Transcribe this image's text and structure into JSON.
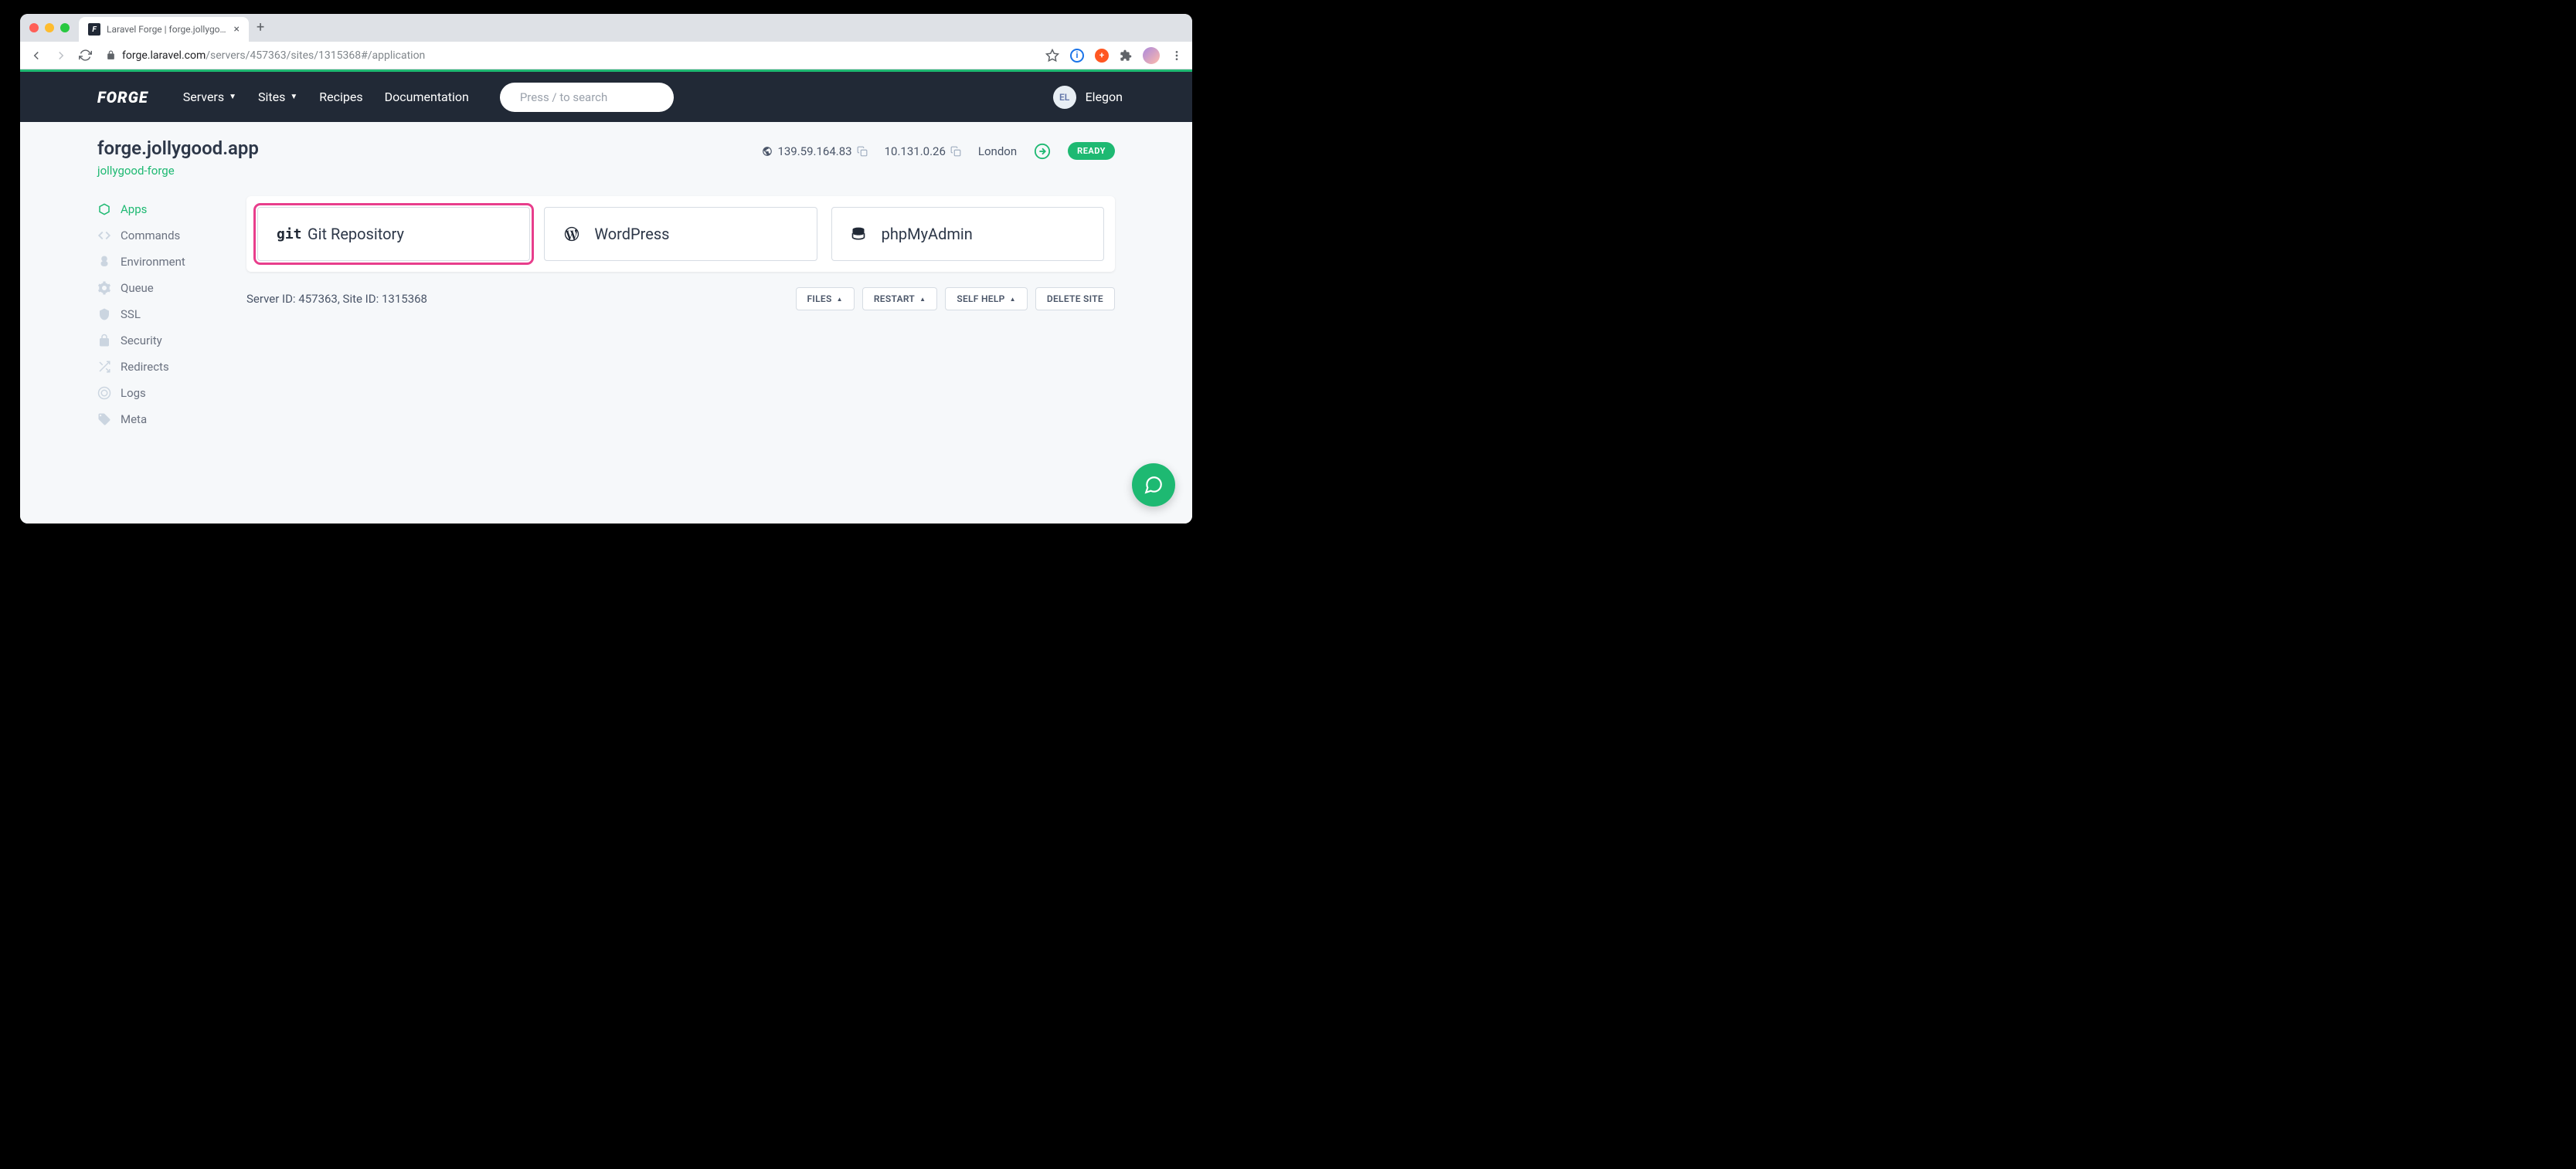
{
  "browser": {
    "tab_title": "Laravel Forge | forge.jollygood",
    "url_host": "forge.laravel.com",
    "url_path": "/servers/457363/sites/1315368#/application"
  },
  "nav": {
    "logo": "FORGE",
    "links": {
      "servers": "Servers",
      "sites": "Sites",
      "recipes": "Recipes",
      "docs": "Documentation"
    },
    "search_placeholder": "Press / to search",
    "user_initials": "EL",
    "user_name": "Elegon"
  },
  "header": {
    "site_title": "forge.jollygood.app",
    "server_name": "jollygood-forge",
    "public_ip": "139.59.164.83",
    "private_ip": "10.131.0.26",
    "location": "London",
    "status": "READY"
  },
  "sidebar": {
    "items": [
      {
        "label": "Apps",
        "icon": "cube-icon",
        "active": true
      },
      {
        "label": "Commands",
        "icon": "code-icon"
      },
      {
        "label": "Environment",
        "icon": "tree-icon"
      },
      {
        "label": "Queue",
        "icon": "gear-icon"
      },
      {
        "label": "SSL",
        "icon": "shield-icon"
      },
      {
        "label": "Security",
        "icon": "lock-icon"
      },
      {
        "label": "Redirects",
        "icon": "shuffle-icon"
      },
      {
        "label": "Logs",
        "icon": "target-icon"
      },
      {
        "label": "Meta",
        "icon": "tag-icon"
      }
    ]
  },
  "apps": {
    "git": "Git Repository",
    "wordpress": "WordPress",
    "phpmyadmin": "phpMyAdmin"
  },
  "footer": {
    "server_id_label": "Server ID: ",
    "server_id": "457363",
    "site_id_label": ", Site ID: ",
    "site_id": "1315368",
    "buttons": {
      "files": "FILES",
      "restart": "RESTART",
      "selfhelp": "SELF HELP",
      "delete": "DELETE SITE"
    }
  }
}
